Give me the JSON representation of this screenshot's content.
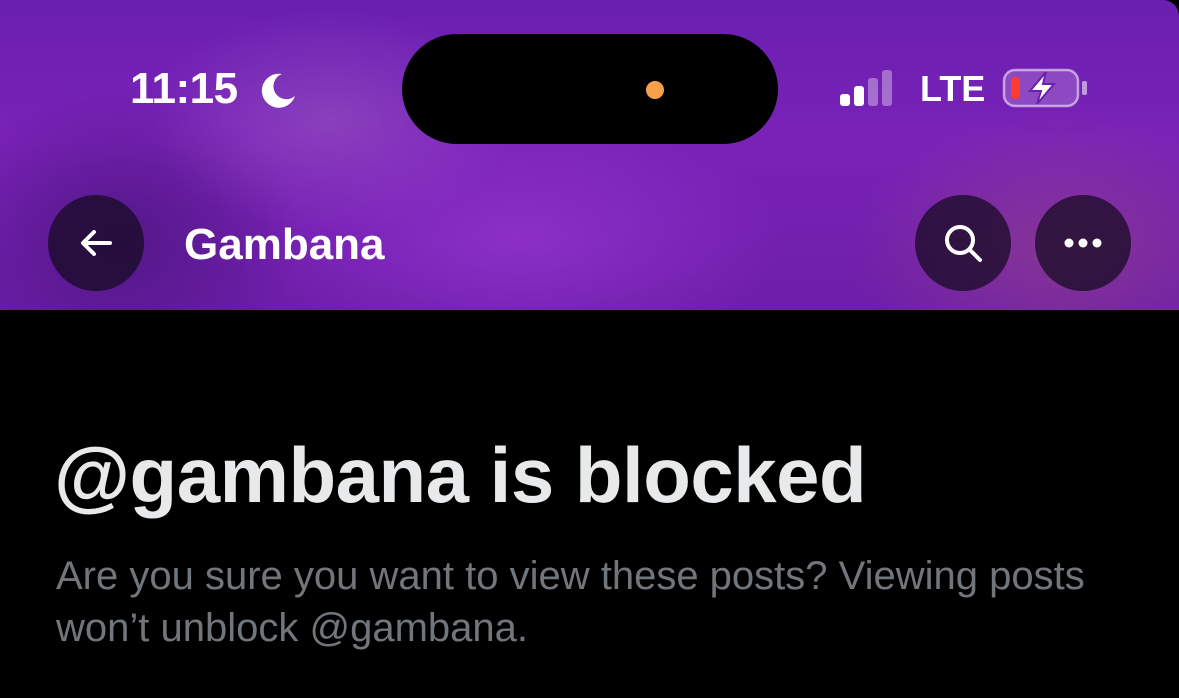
{
  "status_bar": {
    "time": "11:15",
    "focus_icon": "moon-icon",
    "signal_icon": "cellular-signal-icon",
    "network": "LTE",
    "battery_icon": "battery-charging-low-icon"
  },
  "header": {
    "title": "Gambana",
    "back_icon": "arrow-left-icon",
    "search_icon": "search-icon",
    "more_icon": "more-horizontal-icon"
  },
  "blocked": {
    "heading": "@gambana is blocked",
    "message": "Are you sure you want to view these posts? Viewing posts won’t unblock @gambana."
  },
  "colors": {
    "background": "#000000",
    "header_accent": "#7a22b8",
    "heading_text": "#e7e9ea",
    "secondary_text": "#71767b",
    "battery_low": "#ff3b30",
    "camera_indicator": "#f5a04a"
  }
}
